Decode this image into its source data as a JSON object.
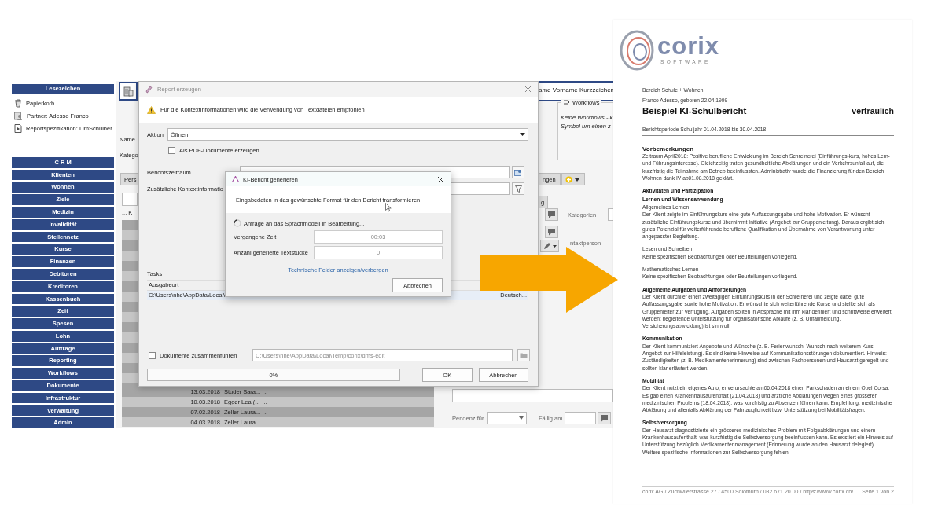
{
  "app": {
    "sidebar": {
      "bookmarks_header": "Lesezeichen",
      "bookmarks": [
        {
          "kind": "trash",
          "label": "Papierkorb"
        },
        {
          "kind": "partner",
          "label": "Partner: Adesso Franco"
        },
        {
          "kind": "report",
          "label": "Reportspezifikation: LlmSchulber"
        }
      ],
      "nav": [
        "C R M",
        "Klienten",
        "Wohnen",
        "Ziele",
        "Medizin",
        "Invalidität",
        "Stellennetz",
        "Kurse",
        "Finanzen",
        "Debitoren",
        "Kreditoren",
        "Kassenbuch",
        "Zeit",
        "Spesen",
        "Lohn",
        "Aufträge",
        "Reporting",
        "Workflows",
        "Dokumente",
        "Infrastruktur",
        "Verwaltung",
        "Admin"
      ]
    },
    "background": {
      "name_label": "Name",
      "category_label": "Katego",
      "tab_label": "Pers",
      "column_label": "... K",
      "rows": [
        {
          "date": "13.03.2018",
          "name": "Studer Sara...",
          "more": ".."
        },
        {
          "date": "10.03.2018",
          "name": "Egger Lea (...",
          "more": ".."
        },
        {
          "date": "07.03.2018",
          "name": "Zeller Laura...",
          "more": ".."
        },
        {
          "date": "04.03.2018",
          "name": "Zeller Laura...",
          "more": ".."
        }
      ],
      "header": "ame Vorname Kurzzeichen",
      "workflows": {
        "title": "Workflows",
        "lines": [
          "Keine Workflows - k",
          "Symbol um einen z"
        ]
      },
      "tab_upper": "ngen",
      "tab_lower": "g",
      "categories_label": "Kategorien",
      "contact_label": "ntaktperson",
      "pending_label": "Pendenz für",
      "due_label": "Fällig am"
    },
    "report_dialog": {
      "title": "Report erzeugen",
      "notice": "Für die Kontextinformationen wird die Verwendung von Textdateien empfohlen",
      "action_label": "Aktion",
      "action_value": "Öffnen",
      "pdf_checkbox": {
        "label": "Als PDF-Dokumente erzeugen",
        "checked": false
      },
      "period_label": "Berichtszeitraum",
      "context_label": "Zusätzliche Kontextinformatio",
      "tasks_label": "Tasks",
      "tasks_column": "Ausgabeort",
      "task_rows": [
        {
          "path": "C:\\Users\\nhe\\AppData\\Local\\",
          "language": "Deutsch..."
        }
      ],
      "merge_checkbox": {
        "label": "Dokumente zusammenführen",
        "checked": false
      },
      "merge_path": "C:\\Users\\nhe\\AppData\\Local\\Temp\\corix\\dms-edit",
      "progress": {
        "level": 0,
        "reading": "0%"
      },
      "buttons": [
        "OK",
        "Abbrechen"
      ]
    },
    "ki_dialog": {
      "title": "KI-Bericht generieren",
      "message": "Eingabedaten in das gewünschte Format für den Bericht transformieren",
      "status": "Anfrage an das Sprachmodell in Bearbeitung...",
      "fields": [
        {
          "label": "Vergangene Zeit",
          "value": "00:03"
        },
        {
          "label": "Anzahl generierte Textstücke",
          "value": "0"
        }
      ],
      "link": "Technische Felder anzeigen/verbergen",
      "button": "Abbrechen"
    }
  },
  "document": {
    "logo": {
      "name": "corix",
      "tagline": "SOFTWARE"
    },
    "department": "Bereich Schule + Wohnen",
    "person": "Franco Adesso, geboren 22.04.1999",
    "title": "Beispiel KI-Schulbericht",
    "classification": "vertraulich",
    "period": "Berichtsperiode Schuljahr 01.04.2018 bis 30.04.2018",
    "blocks": [
      {
        "kind": "section",
        "text": "Vorbemerkungen"
      },
      {
        "kind": "paragraph",
        "text": "Zeitraum April2018: Positive berufliche Entwicklung im Bereich Schreinerei (Einführungs-kurs, hohes Lern- und Führungsinteresse). Gleichzeitig traten gesundheitliche Abklärungen und ein Verkehrsunfall auf, die kurzfristig die Teilnahme am Betrieb beeinflussten. Administrativ wurde die Finanzierung für den Bereich Wohnen dank IV ab01.08.2018 geklärt."
      },
      {
        "kind": "heading",
        "text": "Aktivitäten und Partizipation"
      },
      {
        "kind": "heading",
        "text": "Lernen und Wissensanwendung"
      },
      {
        "kind": "label",
        "text": "Allgemeines Lernen"
      },
      {
        "kind": "paragraph",
        "text": "Der Klient zeigte im Einführungskurs eine gute Auffassungsgabe und hohe Motivation. Er wünscht zusätzliche Einführungskurse und übernimmt Initiative (Angebot zur Gruppenleitung). Daraus ergibt sich gutes Potenzial für weiterführende berufliche Qualifikation und Übernahme von Verantwortung unter angepasster Begleitung."
      },
      {
        "kind": "label",
        "text": "Lesen und Schreiben"
      },
      {
        "kind": "paragraph",
        "text": "Keine spezifischen Beobachtungen oder Beurteilungen vorliegend."
      },
      {
        "kind": "label",
        "text": "Mathematisches Lernen"
      },
      {
        "kind": "paragraph",
        "text": "Keine spezifischen Beobachtungen oder Beurteilungen vorliegend."
      },
      {
        "kind": "heading",
        "text": "Allgemeine Aufgaben und Anforderungen"
      },
      {
        "kind": "paragraph",
        "text": "Der Klient durchlief einen zweitägigen Einführungskurs in der Schreinerei und zeigte dabei gute Auffassungsgabe sowie hohe Motivation. Er wünschte sich weiterführende Kurse und stellte sich als Gruppenleiter zur Verfügung. Aufgaben sollten in Absprache mit ihm klar definiert und schrittweise erweitert werden; begleitende Unterstützung für organisatorische Abläufe (z. B. Unfallmeldung, Versicherungsabwicklung) ist sinnvoll."
      },
      {
        "kind": "heading",
        "text": "Kommunikation"
      },
      {
        "kind": "paragraph",
        "text": "Der Klient kommuniziert Angebote und Wünsche (z. B. Ferienwunsch, Wunsch nach weiterem Kurs, Angebot zur Hilfeleistung). Es sind keine Hinweise auf Kommunikationsstörungen dokumentiert. Hinweis: Zuständigkeiten (z. B. Medikamentenerinnerung) sind zwischen Fachpersonen und Hausarzt geregelt und sollten klar erläutert werden."
      },
      {
        "kind": "heading",
        "text": "Mobilität"
      },
      {
        "kind": "paragraph",
        "text": "Der Klient nutzt ein eigenes Auto; er verursachte am06.04.2018 einen Parkschaden an einem Opel Corsa. Es gab einen Krankenhausaufenthalt (21.04.2018) und ärztliche Abklärungen wegen eines grösseren medizinischen Problems (18.04.2018), was kurzfristig zu Absenzen führen kann. Empfehlung: medizinische Abklärung und allenfalls Abklärung der Fahrtauglichkeit bzw. Unterstützung bei Mobilitätsfragen."
      },
      {
        "kind": "heading",
        "text": "Selbstversorgung"
      },
      {
        "kind": "paragraph",
        "text": "Der Hausarzt diagnostizierte ein grösseres medizinisches Problem mit Folgeabklärungen und einem Krankenhausaufenthalt, was kurzfristig die Selbstversorgung beeinflussen kann. Es existiert ein Hinweis auf Unterstützung bezüglich Medikamentenmanagement (Erinnerung wurde an den Hausarzt delegiert). Weitere spezifische Informationen zur Selbstversorgung fehlen."
      }
    ],
    "footer": "corix AG / Zuchwilerstrasse 27 / 4500 Solothurn / 032 671 20 00 / https://www.corix.ch/",
    "page": "Seite 1 von 2"
  }
}
